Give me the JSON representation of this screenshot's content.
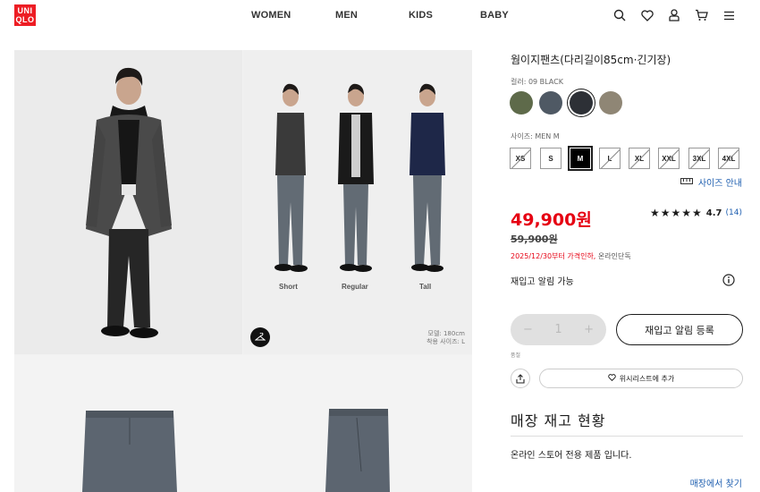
{
  "header": {
    "logo_top": "UNI",
    "logo_bottom": "QLO",
    "nav": [
      "WOMEN",
      "MEN",
      "KIDS",
      "BABY"
    ],
    "icons": [
      "search-icon",
      "heart-icon",
      "user-icon",
      "cart-icon",
      "menu-icon"
    ]
  },
  "gallery": {
    "fit_labels": [
      "Short",
      "Regular",
      "Tall"
    ],
    "model_info_line1": "모델: 180cm",
    "model_info_line2": "착용 사이즈: L"
  },
  "product": {
    "title": "웜이지팬츠(다리길이85cm·긴기장)",
    "color_label": "컬러: 09 BLACK",
    "colors": [
      {
        "name": "olive",
        "hex": "#5e6a4a",
        "selected": false
      },
      {
        "name": "gray",
        "hex": "#4f5964",
        "selected": false
      },
      {
        "name": "black",
        "hex": "#2d3036",
        "selected": true
      },
      {
        "name": "beige",
        "hex": "#8f8675",
        "selected": false
      }
    ],
    "size_label": "사이즈: MEN M",
    "sizes": [
      {
        "label": "XS",
        "available": false
      },
      {
        "label": "S",
        "available": true
      },
      {
        "label": "M",
        "available": true,
        "selected": true
      },
      {
        "label": "L",
        "available": false
      },
      {
        "label": "XL",
        "available": false
      },
      {
        "label": "XXL",
        "available": false
      },
      {
        "label": "3XL",
        "available": false
      },
      {
        "label": "4XL",
        "available": false
      }
    ],
    "size_guide": "사이즈 안내",
    "price": "49,900원",
    "original_price": "59,900원",
    "price_note_red": "2025/12/30부터 가격인하,",
    "price_note_gray": "온라인단독",
    "rating": {
      "stars": "★★★★★",
      "value": "4.7",
      "count": "(14)"
    },
    "restock_text": "재입고 알림 가능",
    "quantity": "1",
    "qty_minus": "−",
    "qty_plus": "+",
    "notify_button": "재입고 알림 등록",
    "tiny_note": "품절",
    "wishlist_button": "위시리스트에 추가",
    "stock_title": "매장 재고 현황",
    "stock_text": "온라인 스토어 전용 제품 입니다.",
    "store_link": "매장에서 찾기"
  },
  "colors": {
    "accent_red": "#e60012",
    "link_blue": "#1f5fb0",
    "logo_red": "#ed1d24"
  }
}
